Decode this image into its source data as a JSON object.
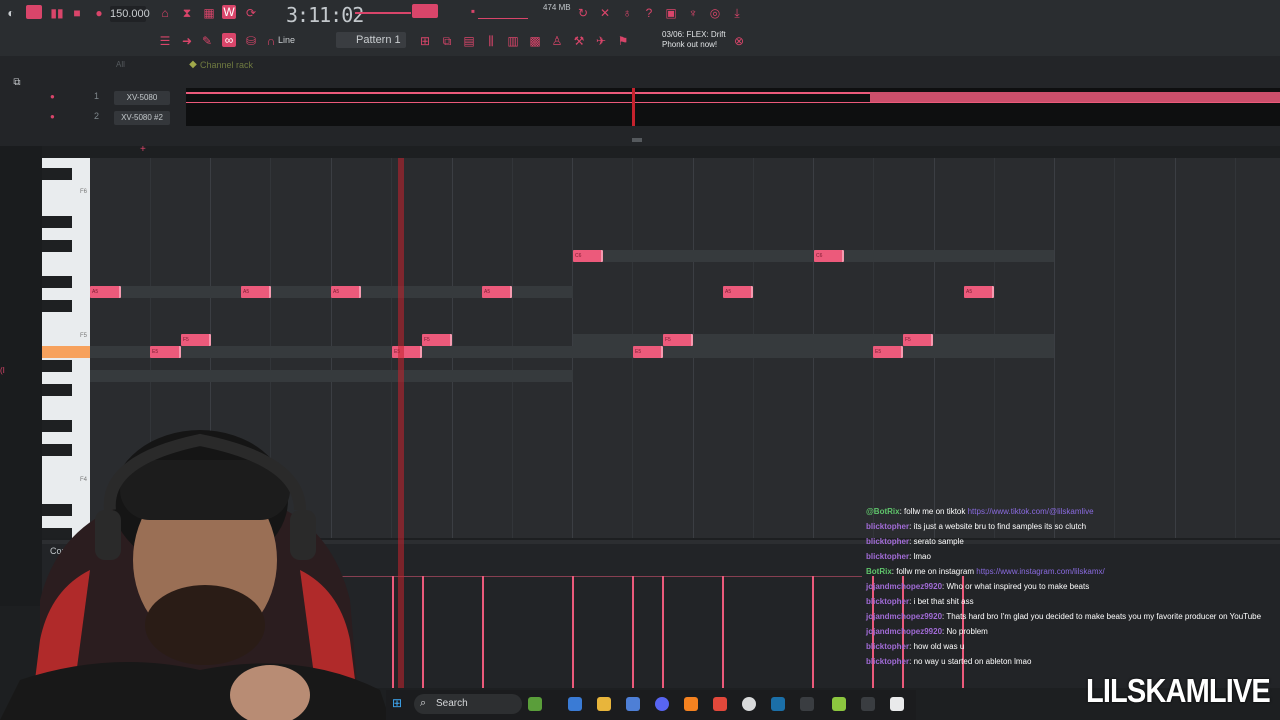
{
  "toolbar": {
    "tempo": "150.000",
    "time": "3:11:02",
    "memory": "474 MB",
    "pattern": "Pattern 1",
    "snap": "Line",
    "news": "03/06: FLEX: Drift Phonk out now!"
  },
  "channel_rack": {
    "title": "Channel rack",
    "filter": "All",
    "channels": [
      {
        "num": "1",
        "name": "XV-5080"
      },
      {
        "num": "2",
        "name": "XV-5080 #2"
      }
    ]
  },
  "piano_roll": {
    "key_labels": [
      "F6",
      "F5",
      "F4"
    ],
    "controller_label": "Contro",
    "notes": [
      {
        "label": "A5"
      },
      {
        "label": "F5"
      },
      {
        "label": "E5"
      },
      {
        "label": "C6"
      }
    ]
  },
  "chat": {
    "lines": [
      {
        "user": "@BotRix",
        "bot": true,
        "msg": ": follw me on tiktok ",
        "link": "https://www.tiktok.com/@lilskamlive"
      },
      {
        "user": "blicktopher",
        "bot": false,
        "msg": ": its just a website bru to find samples its so clutch",
        "link": ""
      },
      {
        "user": "blicktopher",
        "bot": false,
        "msg": ": serato sample",
        "link": ""
      },
      {
        "user": "blicktopher",
        "bot": false,
        "msg": ": lmao",
        "link": ""
      },
      {
        "user": "BotRix",
        "bot": true,
        "msg": ": follw me on instagram ",
        "link": "https://www.instagram.com/lilskamx/"
      },
      {
        "user": "jojandmchopez9920",
        "bot": false,
        "msg": ": Who or what inspired you to make beats",
        "link": ""
      },
      {
        "user": "blicktopher",
        "bot": false,
        "msg": ": i bet that shit ass",
        "link": ""
      },
      {
        "user": "jojandmchopez9920",
        "bot": false,
        "msg": ": Thats hard bro I'm glad you decided to make beats you my favorite producer on YouTube",
        "link": ""
      },
      {
        "user": "jojandmchopez9920",
        "bot": false,
        "msg": ": No problem",
        "link": ""
      },
      {
        "user": "blicktopher",
        "bot": false,
        "msg": ": how old was u",
        "link": ""
      },
      {
        "user": "blicktopher",
        "bot": false,
        "msg": ": no way u started on ableton lmao",
        "link": ""
      }
    ]
  },
  "taskbar": {
    "search_placeholder": "Search"
  },
  "watermark": "LILSKAMLIVE",
  "colors": {
    "accent": "#ec5a7b",
    "playhead": "#c5222d",
    "background": "#2a2c2f"
  }
}
